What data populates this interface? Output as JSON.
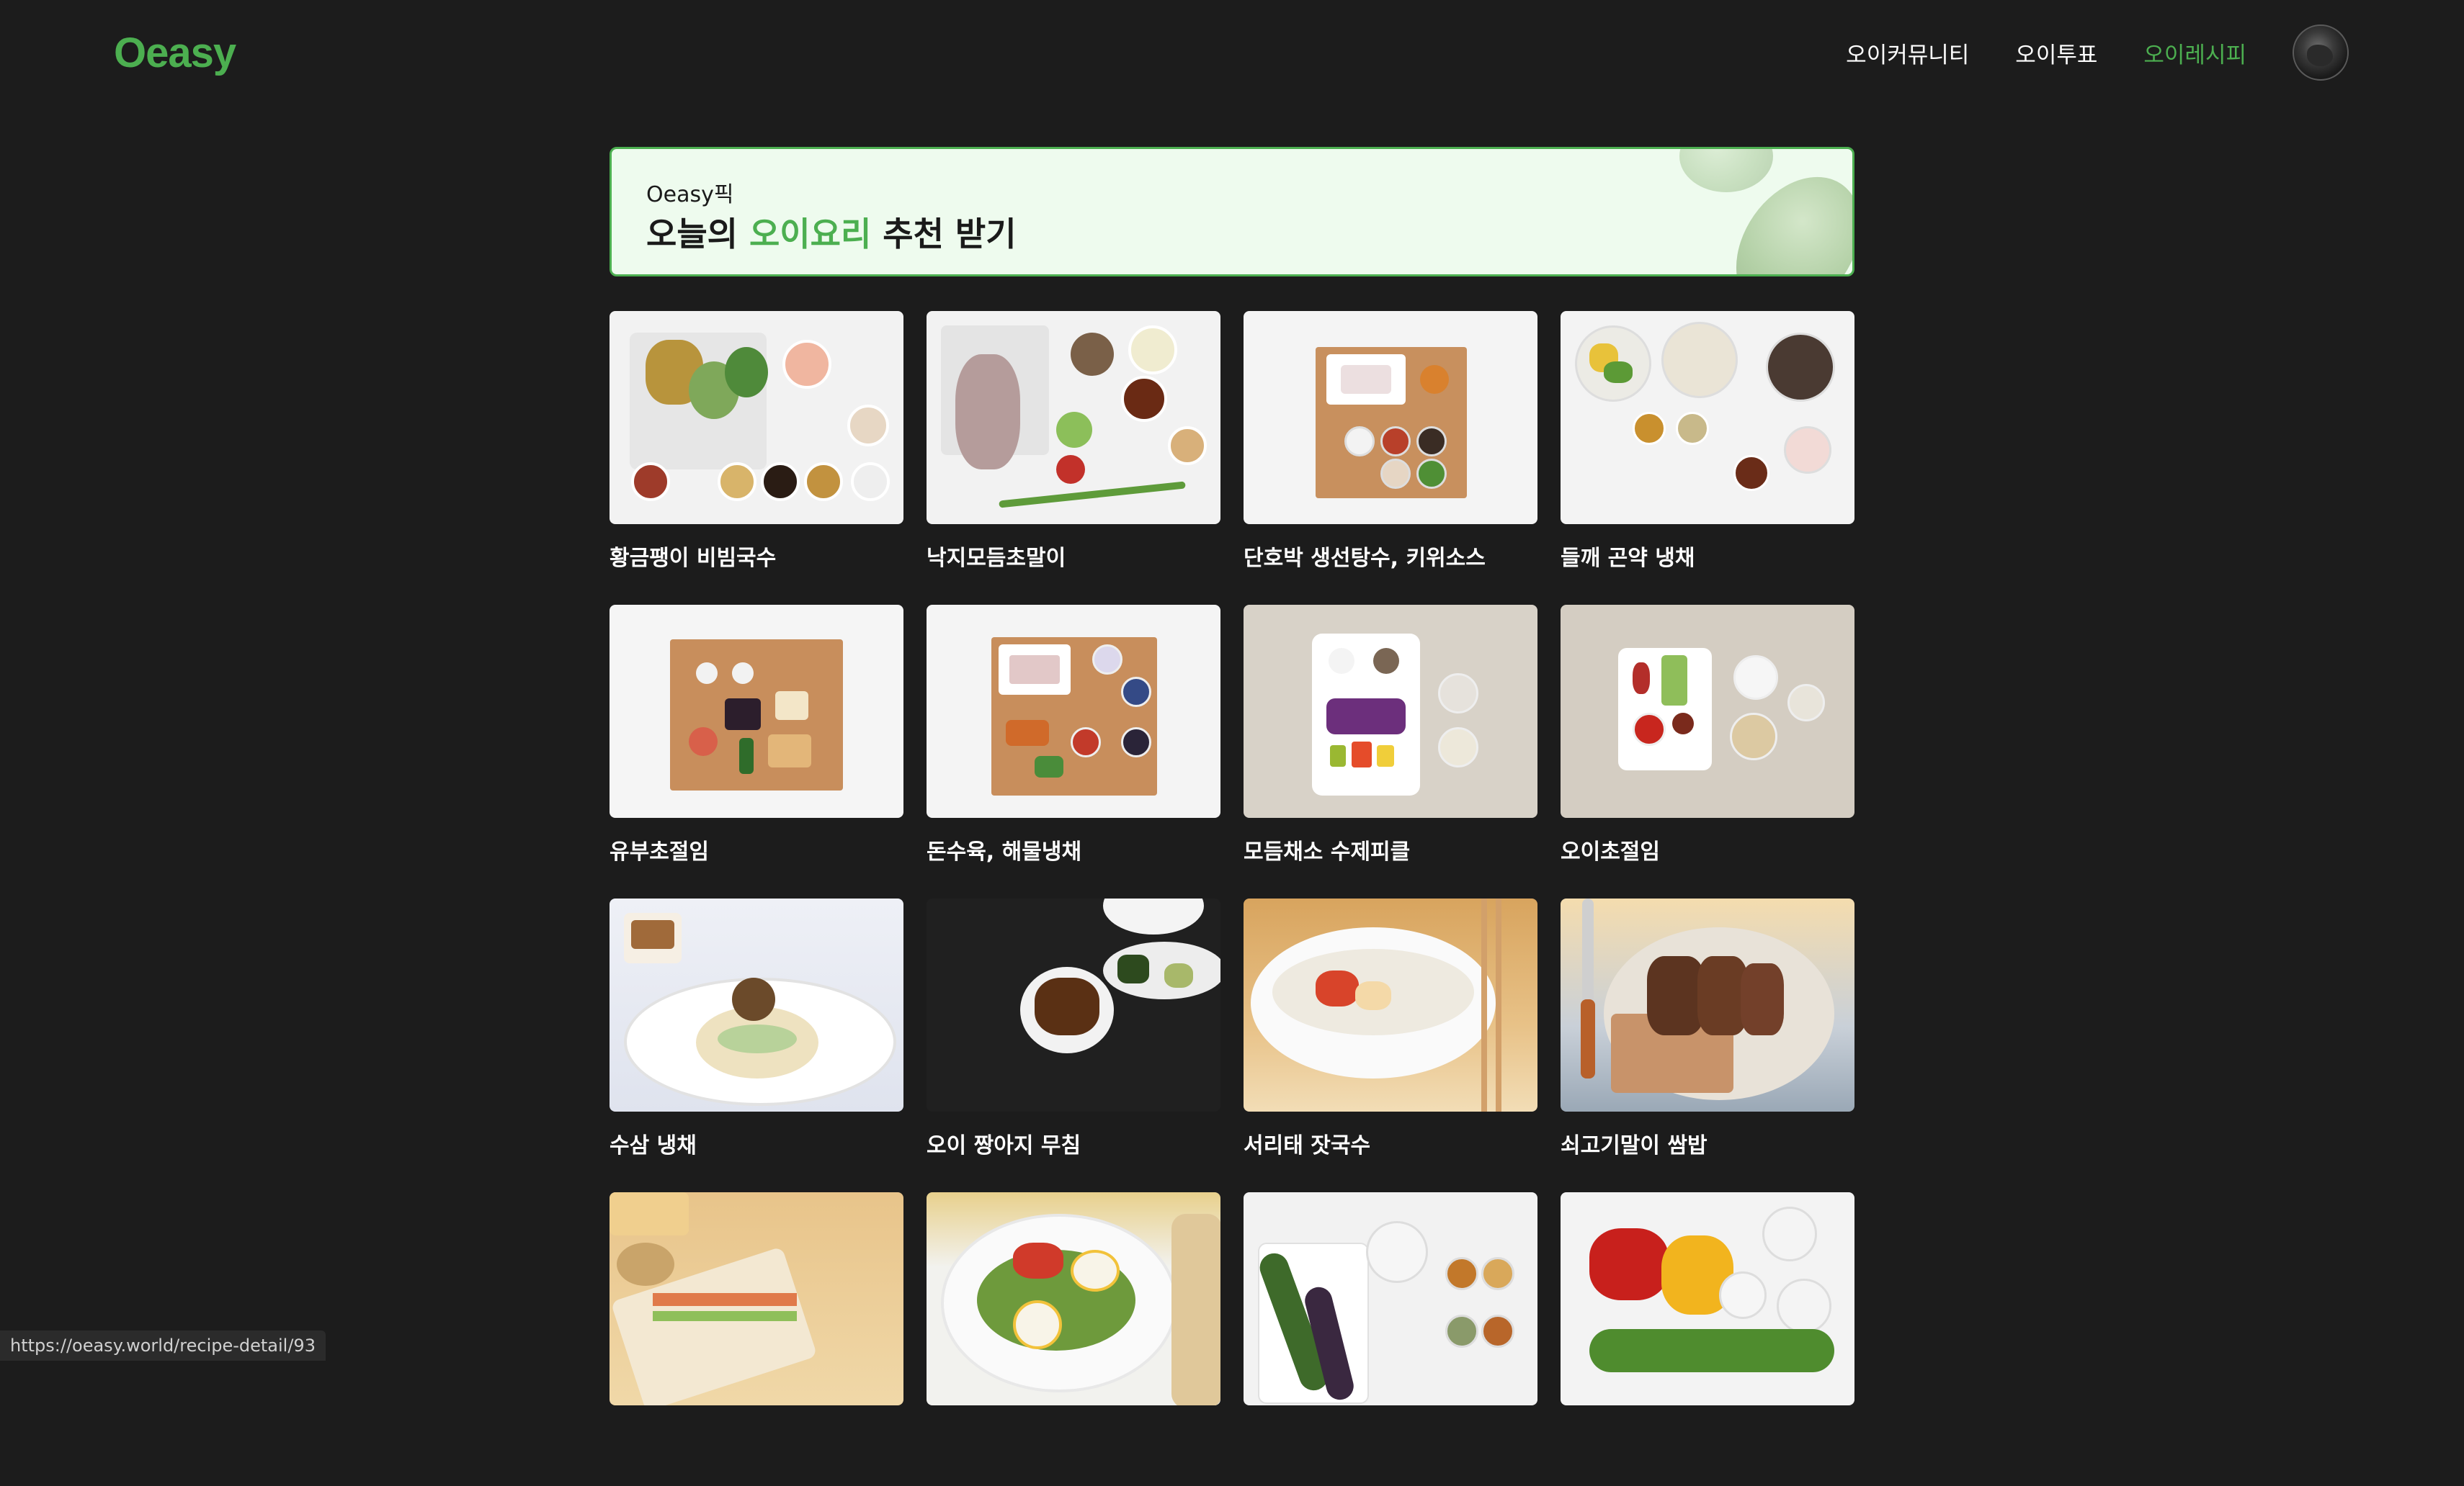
{
  "header": {
    "logo": "Oeasy",
    "nav": [
      {
        "label": "오이커뮤니티",
        "active": false
      },
      {
        "label": "오이투표",
        "active": false
      },
      {
        "label": "오이레시피",
        "active": true
      }
    ]
  },
  "banner": {
    "subtitle": "Oeasy픽",
    "title_pre": "오늘의 ",
    "title_highlight": "오이요리",
    "title_post": " 추천 받기"
  },
  "recipes": [
    {
      "title": "황금팽이 비빔국수"
    },
    {
      "title": "낙지모듬초말이"
    },
    {
      "title": "단호박 생선탕수, 키위소스"
    },
    {
      "title": "들깨 곤약 냉채"
    },
    {
      "title": "유부초절임"
    },
    {
      "title": "돈수육, 해물냉채"
    },
    {
      "title": "모듬채소 수제피클"
    },
    {
      "title": "오이초절임"
    },
    {
      "title": "수삼 냉채"
    },
    {
      "title": "오이 짱아지 무침"
    },
    {
      "title": "서리태 잣국수"
    },
    {
      "title": "쇠고기말이 쌈밥"
    },
    {
      "title": ""
    },
    {
      "title": ""
    },
    {
      "title": ""
    },
    {
      "title": ""
    }
  ],
  "status_url": "https://oeasy.world/recipe-detail/93",
  "colors": {
    "accent": "#4caf50",
    "background": "#1c1c1c",
    "banner_bg": "#eefbee"
  }
}
